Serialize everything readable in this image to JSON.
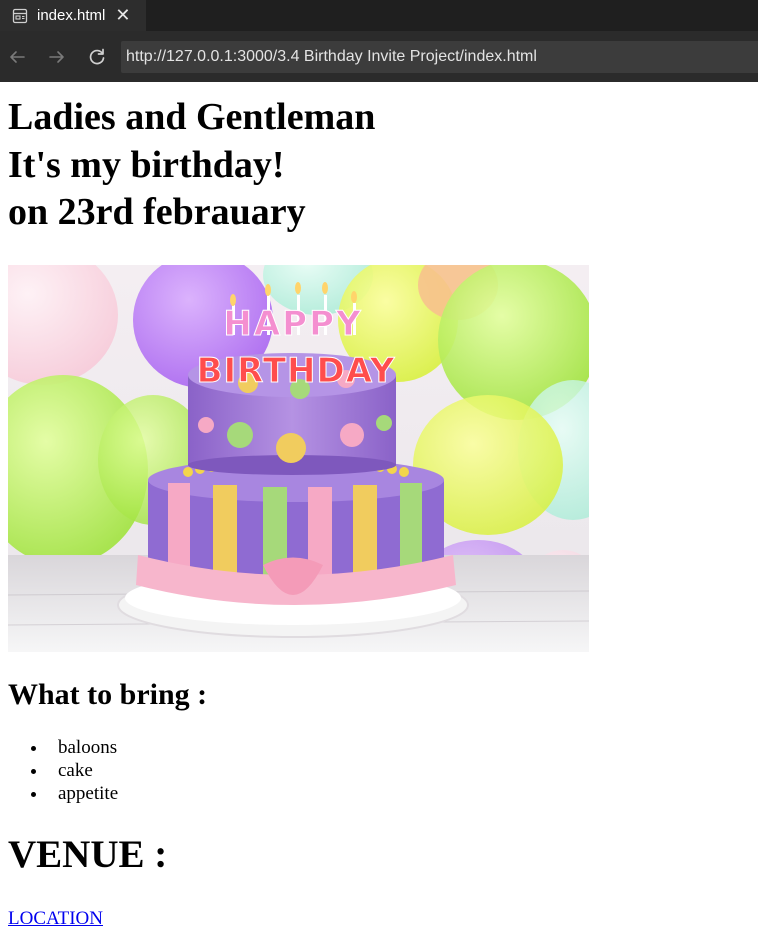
{
  "browser": {
    "tab_title": "index.html",
    "url": "http://127.0.0.1:3000/3.4 Birthday Invite Project/index.html"
  },
  "page": {
    "heading_lines": [
      "Ladies and Gentleman",
      "It's my birthday!",
      "on 23rd febrauary"
    ],
    "image_text_top": "HAPPY",
    "image_text_bottom": "BIRTHDAY",
    "bring_heading": "What to bring :",
    "bring_items": [
      "baloons",
      "cake",
      "appetite"
    ],
    "venue_heading": "VENUE :",
    "location_link": "LOCATION"
  },
  "colors": {
    "link": "#0000ee",
    "tabbar_bg": "#1f1f1f",
    "navbar_bg": "#2b2b2b",
    "address_bg": "#3c3c3c"
  }
}
